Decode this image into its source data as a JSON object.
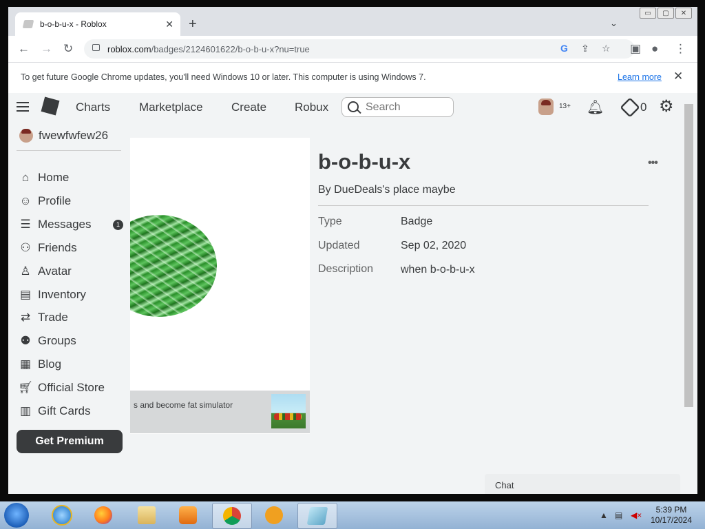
{
  "browser": {
    "tab_title": "b-o-b-u-x - Roblox",
    "tab_close": "✕",
    "new_tab": "+",
    "tab_menu": "⌄",
    "url_host": "roblox.com",
    "url_path": "/badges/2124601622/b-o-b-u-x?nu=true",
    "window_controls": [
      "▭",
      "▢",
      "✕"
    ],
    "infobar_message": "To get future Google Chrome updates, you'll need Windows 10 or later. This computer is using Windows 7.",
    "infobar_link": "Learn more",
    "infobar_close": "✕"
  },
  "topnav": {
    "links": [
      "Charts",
      "Marketplace",
      "Create",
      "Robux"
    ],
    "search_placeholder": "Search",
    "age_label": "13+",
    "robux_count": "0"
  },
  "sidebar": {
    "username": "fwewfwfew26",
    "items": [
      {
        "label": "Home",
        "icon": "home-icon"
      },
      {
        "label": "Profile",
        "icon": "profile-icon"
      },
      {
        "label": "Messages",
        "icon": "messages-icon",
        "badge": "1"
      },
      {
        "label": "Friends",
        "icon": "friends-icon"
      },
      {
        "label": "Avatar",
        "icon": "avatar-icon"
      },
      {
        "label": "Inventory",
        "icon": "inventory-icon"
      },
      {
        "label": "Trade",
        "icon": "trade-icon"
      },
      {
        "label": "Groups",
        "icon": "groups-icon"
      },
      {
        "label": "Blog",
        "icon": "blog-icon"
      },
      {
        "label": "Official Store",
        "icon": "store-icon"
      },
      {
        "label": "Gift Cards",
        "icon": "gift-card-icon"
      }
    ],
    "premium_button": "Get Premium"
  },
  "badge": {
    "title": "b-o-b-u-x",
    "creator": "By DueDeals's place maybe",
    "more": "•••",
    "details": [
      {
        "label": "Type",
        "value": "Badge"
      },
      {
        "label": "Updated",
        "value": "Sep 02, 2020"
      },
      {
        "label": "Description",
        "value": "when b-o-b-u-x"
      }
    ],
    "game_name": "s and become fat simulator"
  },
  "chat": {
    "label": "Chat"
  },
  "taskbar": {
    "time": "5:39 PM",
    "date": "10/17/2024"
  },
  "colors": {
    "roblox_text": "#393b3d",
    "page_bg": "#f2f4f5",
    "link_blue": "#1a73e8"
  }
}
